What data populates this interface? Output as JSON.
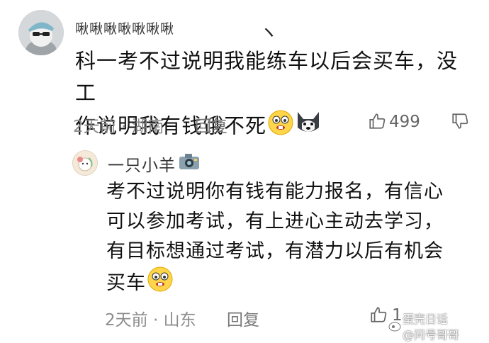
{
  "main_comment": {
    "username": "啾啾啾啾啾啾啾",
    "deco_mark": "ヽ",
    "text_line1": "科一考不过说明我能练车以后会买车，没工",
    "text_line2": "作说明我有钱饿不死",
    "date": "2天前",
    "dot": "·",
    "location": "湖南",
    "reply_label": "回复",
    "likes": "499"
  },
  "reply_comment": {
    "username": "一只小羊",
    "text_line1": "考不过说明你有钱有能力报名，有信心",
    "text_line2": "可以参加考试，有上进心主动去学习，",
    "text_line3": "有目标想通过考试，有潜力以后有机会",
    "text_line4": "买车",
    "date": "2天前",
    "dot": "·",
    "location": "山东",
    "reply_label": "回复",
    "likes": "1"
  },
  "watermark": {
    "line1": "蛋壳日话",
    "line2": "@问号哥哥"
  },
  "icons": {
    "emoji_grin": "grin-emoji-icon",
    "emoji_husky": "husky-emoji-icon",
    "emoji_camera": "camera-emoji-icon",
    "like": "thumb-up-icon",
    "dislike": "thumb-down-icon"
  }
}
